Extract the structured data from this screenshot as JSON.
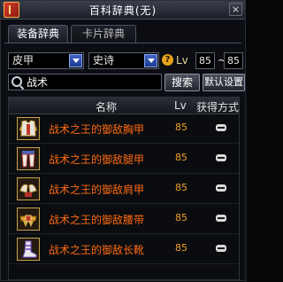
{
  "window": {
    "title": "百科辞典(无)",
    "close_label": "×"
  },
  "tabs": [
    {
      "label": "装备辞典",
      "active": true
    },
    {
      "label": "卡片辞典",
      "active": false
    }
  ],
  "filters": {
    "type_value": "皮甲",
    "rarity_value": "史诗",
    "help_label": "?",
    "lv_label": "Lv",
    "lv_min": "85",
    "range_sep": "~",
    "lv_max": "85"
  },
  "search": {
    "value": "战术",
    "button_label": "搜索",
    "reset_label": "默认设置"
  },
  "table": {
    "columns": [
      "名称",
      "Lv",
      "获得方式"
    ],
    "rows": [
      {
        "icon": "chest-armor-icon",
        "name": "战术之王的御敌胸甲",
        "lv": "85",
        "acquire": "minus-icon"
      },
      {
        "icon": "leg-armor-icon",
        "name": "战术之王的御敌腿甲",
        "lv": "85",
        "acquire": "minus-icon"
      },
      {
        "icon": "shoulder-armor-icon",
        "name": "战术之王的御敌肩甲",
        "lv": "85",
        "acquire": "minus-icon"
      },
      {
        "icon": "belt-icon",
        "name": "战术之王的御敌腰带",
        "lv": "85",
        "acquire": "minus-icon"
      },
      {
        "icon": "boots-icon",
        "name": "战术之王的御敌长靴",
        "lv": "85",
        "acquire": "minus-icon"
      }
    ]
  },
  "colors": {
    "item_name": "#ff6a10",
    "level": "#f0a020",
    "accent_blue": "#3f63c8"
  }
}
